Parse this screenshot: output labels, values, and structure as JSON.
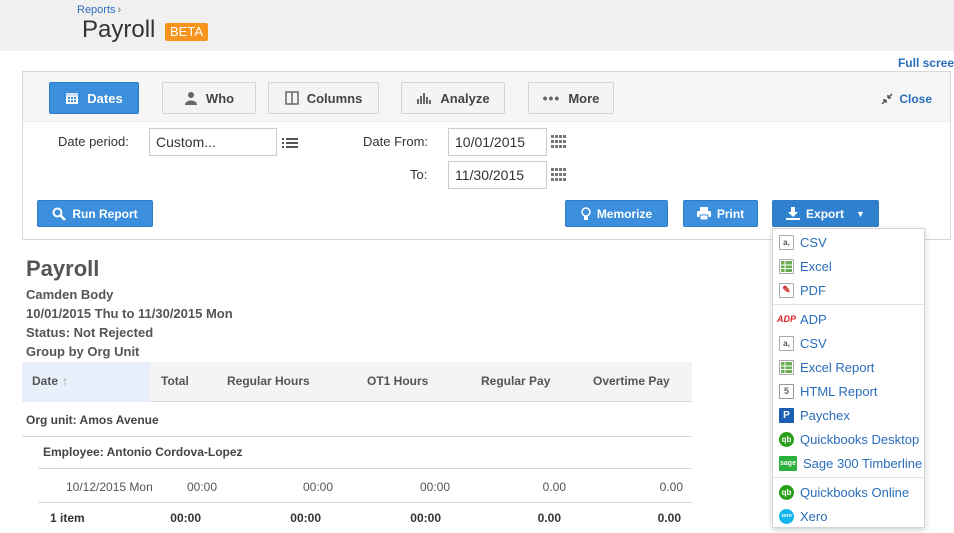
{
  "header": {
    "breadcrumb": "Reports",
    "breadcrumb_sep": "›",
    "title": "Payroll",
    "badge": "BETA",
    "fullscreen": "Full scree"
  },
  "tabs": [
    {
      "label": "Dates",
      "icon": "calendar-icon",
      "active": true
    },
    {
      "label": "Who",
      "icon": "person-icon",
      "active": false
    },
    {
      "label": "Columns",
      "icon": "columns-icon",
      "active": false
    },
    {
      "label": "Analyze",
      "icon": "bar-chart-icon",
      "active": false
    },
    {
      "label": "More",
      "icon": "dots-icon",
      "active": false
    }
  ],
  "close_label": "Close",
  "filters": {
    "period_label": "Date period:",
    "period_value": "Custom...",
    "from_label": "Date From:",
    "from_value": "10/01/2015",
    "to_label": "To:",
    "to_value": "11/30/2015"
  },
  "buttons": {
    "run": "Run Report",
    "memorize": "Memorize",
    "print": "Print",
    "export": "Export"
  },
  "export_menu": {
    "section1": [
      "CSV",
      "Excel",
      "PDF"
    ],
    "section2": [
      "ADP",
      "CSV",
      "Excel Report",
      "HTML Report",
      "Paychex",
      "Quickbooks Desktop",
      "Sage 300 Timberline"
    ],
    "section3": [
      "Quickbooks Online",
      "Xero"
    ]
  },
  "report": {
    "title": "Payroll",
    "company": "Camden Body",
    "range": "10/01/2015 Thu to 11/30/2015 Mon",
    "status": "Status: Not Rejected",
    "group_by": "Group by Org Unit",
    "columns": [
      "Date",
      "Total",
      "Regular Hours",
      "OT1 Hours",
      "Regular Pay",
      "Overtime Pay"
    ],
    "org_unit": "Org unit: Amos Avenue",
    "employee": "Employee: Antonio Cordova-Lopez",
    "row": [
      "10/12/2015 Mon",
      "00:00",
      "00:00",
      "00:00",
      "0.00",
      "0.00"
    ],
    "summary": [
      "1 item",
      "00:00",
      "00:00",
      "00:00",
      "0.00",
      "0.00"
    ]
  },
  "colors": {
    "accent": "#3c8fdd",
    "link": "#2a6ebb",
    "badge": "#f7941d"
  }
}
